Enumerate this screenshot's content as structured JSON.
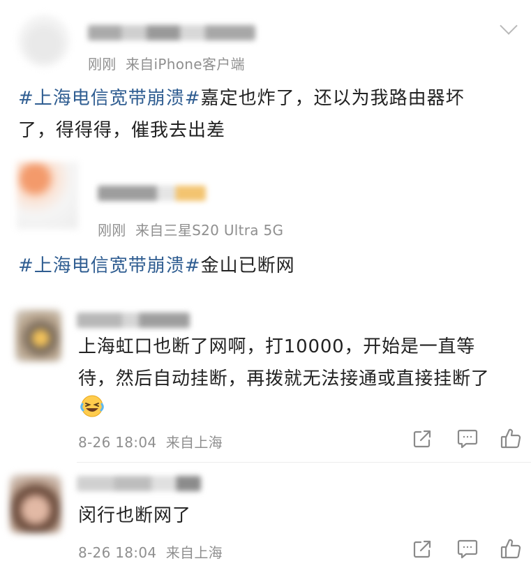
{
  "post1": {
    "time": "刚刚",
    "source": "来自iPhone客户端",
    "hashtag": "#上海电信宽带崩溃#",
    "text_line1": "嘉定也炸了，还以为我路由器坏",
    "text_line2": "了，得得得，催我去出差"
  },
  "post2": {
    "time": "刚刚",
    "source": "来自三星S20 Ultra 5G",
    "hashtag": "#上海电信宽带崩溃#",
    "text": "金山已断网"
  },
  "comment1": {
    "text_line1": "上海虹口也断了网啊，打10000，开始是一直等",
    "text_line2": "待，然后自动挂断，再拨就无法接通或直接挂断了",
    "emoji": "😂",
    "date": "8-26 18:04",
    "location": "来自上海"
  },
  "comment2": {
    "text": "闵行也断网了",
    "date": "8-26 18:04",
    "location": "来自上海"
  },
  "colors": {
    "hashtag": "#2f5d91",
    "meta": "#8f8f8f",
    "body": "#222222"
  },
  "icons": [
    "chevron-down-icon",
    "share-icon",
    "comment-icon",
    "like-icon",
    "laughing-emoji-icon"
  ]
}
